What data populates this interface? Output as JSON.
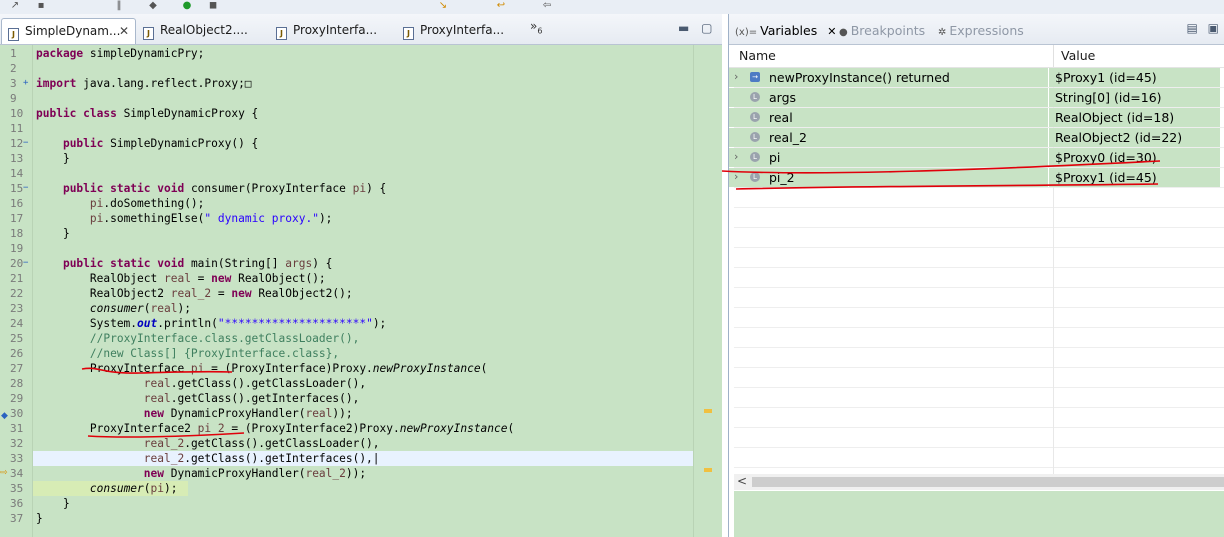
{
  "editor": {
    "tabs": [
      {
        "label": "SimpleDynam...",
        "active": true
      },
      {
        "label": "RealObject2....",
        "active": false
      },
      {
        "label": "ProxyInterfa...",
        "active": false
      },
      {
        "label": "ProxyInterfa...",
        "active": false
      }
    ],
    "overflow": "»",
    "overflow_count": "6",
    "close_glyph": "✕",
    "code_lines": [
      {
        "n": "1",
        "html": "<span class=\"k\">package</span> simpleDynamicPry;"
      },
      {
        "n": "2",
        "html": ""
      },
      {
        "n": "3",
        "html": "<span class=\"k\">import</span> java.lang.reflect.Proxy;□",
        "fold": "+"
      },
      {
        "n": "9",
        "html": ""
      },
      {
        "n": "10",
        "html": "<span class=\"k\">public class</span> SimpleDynamicProxy {"
      },
      {
        "n": "11",
        "html": ""
      },
      {
        "n": "12",
        "html": "    <span class=\"k\">public</span> SimpleDynamicProxy() {",
        "fold": "−"
      },
      {
        "n": "13",
        "html": "    }"
      },
      {
        "n": "14",
        "html": ""
      },
      {
        "n": "15",
        "html": "    <span class=\"k\">public static void</span> consumer(ProxyInterface <span class=\"v\">pi</span>) {",
        "fold": "−"
      },
      {
        "n": "16",
        "html": "        <span class=\"v\">pi</span>.doSomething();"
      },
      {
        "n": "17",
        "html": "        <span class=\"v\">pi</span>.somethingElse(<span class=\"s\">\" dynamic proxy.\"</span>);"
      },
      {
        "n": "18",
        "html": "    }"
      },
      {
        "n": "19",
        "html": ""
      },
      {
        "n": "20",
        "html": "    <span class=\"k\">public static void</span> main(String[] <span class=\"v\">args</span>) {",
        "fold": "−"
      },
      {
        "n": "21",
        "html": "        RealObject <span class=\"v\">real</span> = <span class=\"k\">new</span> RealObject();"
      },
      {
        "n": "22",
        "html": "        RealObject2 <span class=\"v\">real_2</span> = <span class=\"k\">new</span> RealObject2();"
      },
      {
        "n": "23",
        "html": "        <span class=\"i\">consumer</span>(<span class=\"v\">real</span>);"
      },
      {
        "n": "24",
        "html": "        System.<span class=\"f\">out</span>.println(<span class=\"s\">\"*********************\"</span>);"
      },
      {
        "n": "25",
        "html": "        <span class=\"c\">//ProxyInterface.class.getClassLoader(),</span>"
      },
      {
        "n": "26",
        "html": "        <span class=\"c\">//new Class[] {ProxyInterface.class},</span>"
      },
      {
        "n": "27",
        "html": "        ProxyInterface <span class=\"v\">pi</span> = (ProxyInterface)Proxy.<span class=\"i\">newProxyInstance</span>("
      },
      {
        "n": "28",
        "html": "                <span class=\"v\">real</span>.getClass().getClassLoader(),"
      },
      {
        "n": "29",
        "html": "                <span class=\"v\">real</span>.getClass().getInterfaces(),"
      },
      {
        "n": "30",
        "html": "                <span class=\"k\">new</span> DynamicProxyHandler(<span class=\"v\">real</span>));"
      },
      {
        "n": "31",
        "html": "        ProxyInterface2 <span class=\"v\">pi_2</span> = (ProxyInterface2)Proxy.<span class=\"i\">newProxyInstance</span>("
      },
      {
        "n": "32",
        "html": "                <span class=\"v\">real_2</span>.getClass().getClassLoader(),"
      },
      {
        "n": "33",
        "html": "                <span class=\"v\">real_2</span>.getClass().getInterfaces(),|"
      },
      {
        "n": "34",
        "html": "                <span class=\"k\">new</span> DynamicProxyHandler(<span class=\"v\">real_2</span>));"
      },
      {
        "n": "35",
        "html": "        <span class=\"i\">consumer</span>(<span class=\"v\">pi</span>);"
      },
      {
        "n": "36",
        "html": "    }"
      },
      {
        "n": "37",
        "html": "}"
      }
    ]
  },
  "debug_view": {
    "tabs": {
      "variables": "Variables",
      "variables_prefix": "(x)=",
      "variables_close": "✕",
      "breakpoints": "Breakpoints",
      "expressions": "Expressions"
    },
    "columns": {
      "name": "Name",
      "value": "Value"
    },
    "variables": [
      {
        "name": "newProxyInstance() returned",
        "value": "$Proxy1  (id=45)",
        "expandable": true,
        "icon": "return-icon"
      },
      {
        "name": "args",
        "value": "String[0]  (id=16)",
        "expandable": false,
        "icon": "local-var-icon"
      },
      {
        "name": "real",
        "value": "RealObject  (id=18)",
        "expandable": false,
        "icon": "local-var-icon"
      },
      {
        "name": "real_2",
        "value": "RealObject2  (id=22)",
        "expandable": false,
        "icon": "local-var-icon"
      },
      {
        "name": "pi",
        "value": "$Proxy0  (id=30)",
        "expandable": true,
        "icon": "local-var-icon"
      },
      {
        "name": "pi_2",
        "value": "$Proxy1  (id=45)",
        "expandable": true,
        "icon": "local-var-icon"
      }
    ]
  },
  "colors": {
    "editor_bg": "#c8e3c5",
    "annotation_red": "#e0000a",
    "keyword": "#7f0055",
    "string": "#2a00ff",
    "comment": "#3f7f5f"
  }
}
